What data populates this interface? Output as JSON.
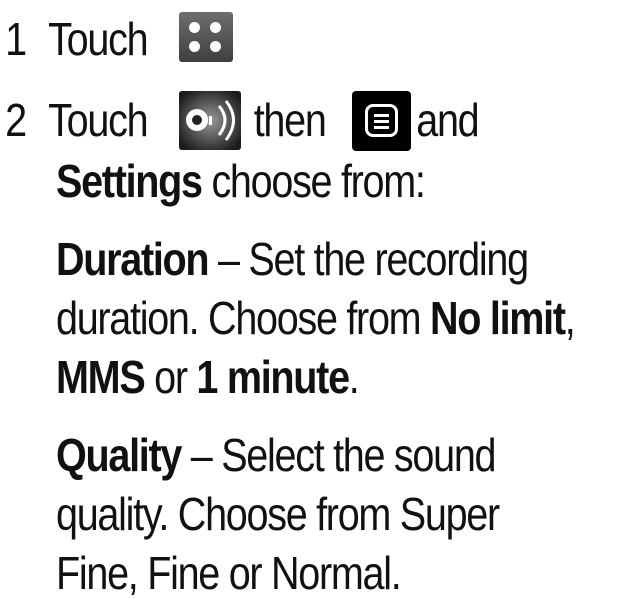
{
  "steps": [
    {
      "number": "1",
      "text_before_icon": "Touch",
      "icon_name": "apps-grid-icon",
      "text_after_icon": "."
    },
    {
      "number": "2",
      "text_before_icon": "Touch",
      "icon_name": "voice-recorder-icon",
      "connector": "then",
      "icon2_name": "menu-icon",
      "text_after_icon2": "and",
      "line2_bold": "Settings",
      "line2_rest": " choose from:"
    }
  ],
  "options": [
    {
      "term": "Duration",
      "desc_line1": " – Set the recording",
      "desc_line2_a": "duration. Choose from ",
      "desc_line2_bold": "No limit",
      "desc_line2_b": ",",
      "desc_line3_bold_a": "MMS",
      "desc_line3_mid": " or ",
      "desc_line3_bold_b": "1 minute",
      "desc_line3_end": "."
    },
    {
      "term": "Quality",
      "desc_line1": " – Select the sound",
      "desc_line2": "quality. Choose from Super",
      "desc_line3": "Fine, Fine or Normal."
    }
  ]
}
